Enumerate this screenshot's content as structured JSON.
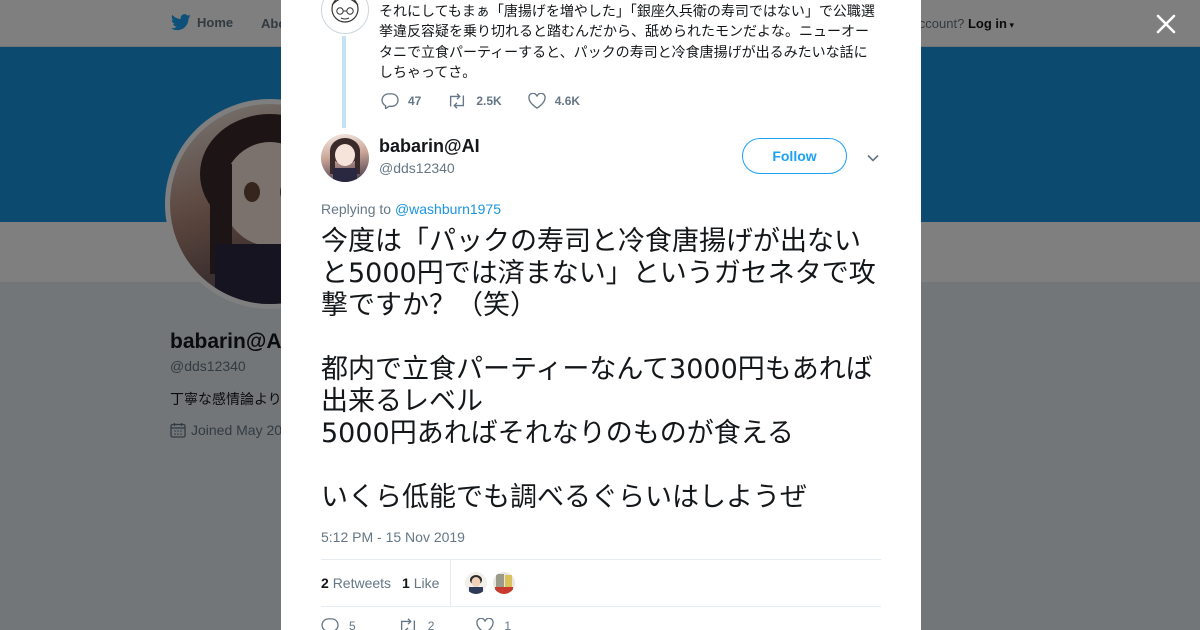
{
  "nav": {
    "home_label": "Home",
    "about_label": "Abo",
    "account_text": "ccount?",
    "login_label": "Log in"
  },
  "profile": {
    "name": "babarin@A",
    "handle": "@dds12340",
    "bio": "丁寧な感情論より",
    "joined": "Joined May 20"
  },
  "parent_tweet": {
    "text": "それにしてもまぁ「唐揚げを増やした」「銀座久兵衛の寿司ではない」で公職選挙違反容疑を乗り切れると踏むんだから、舐められたモンだよな。ニューオータニで立食パーティーすると、パックの寿司と冷食唐揚げが出るみたいな話にしちゃってさ。",
    "replies": "47",
    "retweets": "2.5K",
    "likes": "4.6K"
  },
  "tweet": {
    "author_name": "babarin@AI",
    "author_handle": "@dds12340",
    "follow_label": "Follow",
    "replying_prefix": "Replying to",
    "replying_to": "@washburn1975",
    "text": "今度は「パックの寿司と冷食唐揚げが出ないと5000円では済まない」というガセネタで攻撃ですか？（笑）\n\n都内で立食パーティーなんて3000円もあれば出来るレベル\n5000円あればそれなりのものが食える\n\nいくら低能でも調べるぐらいはしようぜ",
    "timestamp": "5:12 PM - 15 Nov 2019",
    "retweet_count": "2",
    "retweet_label": "Retweets",
    "like_count": "1",
    "like_label": "Like",
    "reply_count": "5",
    "retweet_action_count": "2",
    "like_action_count": "1"
  },
  "colors": {
    "brand": "#1da1f2",
    "banner": "#1b95e0",
    "text_primary": "#14171a",
    "text_secondary": "#657786"
  },
  "icons": [
    "twitter-bird-icon",
    "close-icon",
    "reply-icon",
    "retweet-icon",
    "like-icon",
    "chevron-down-icon",
    "calendar-icon"
  ]
}
